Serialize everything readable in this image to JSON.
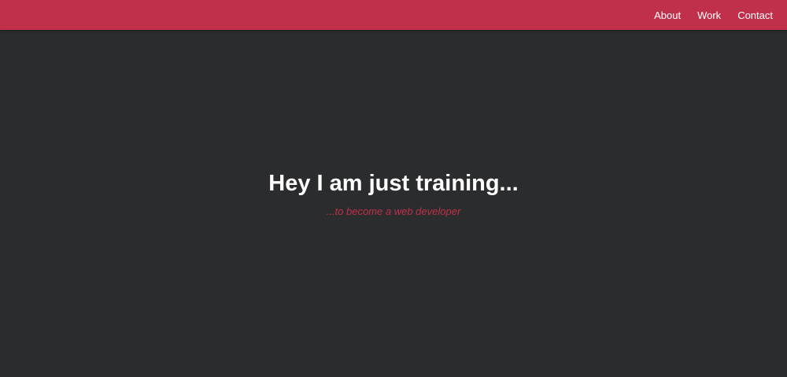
{
  "nav": {
    "links": [
      {
        "label": "About"
      },
      {
        "label": "Work"
      },
      {
        "label": "Contact"
      }
    ]
  },
  "hero": {
    "title": "Hey I am just training...",
    "subtitle": "...to become a web developer"
  },
  "colors": {
    "background": "#2b2c2e",
    "accent": "#c0304a",
    "text": "#ffffff"
  }
}
